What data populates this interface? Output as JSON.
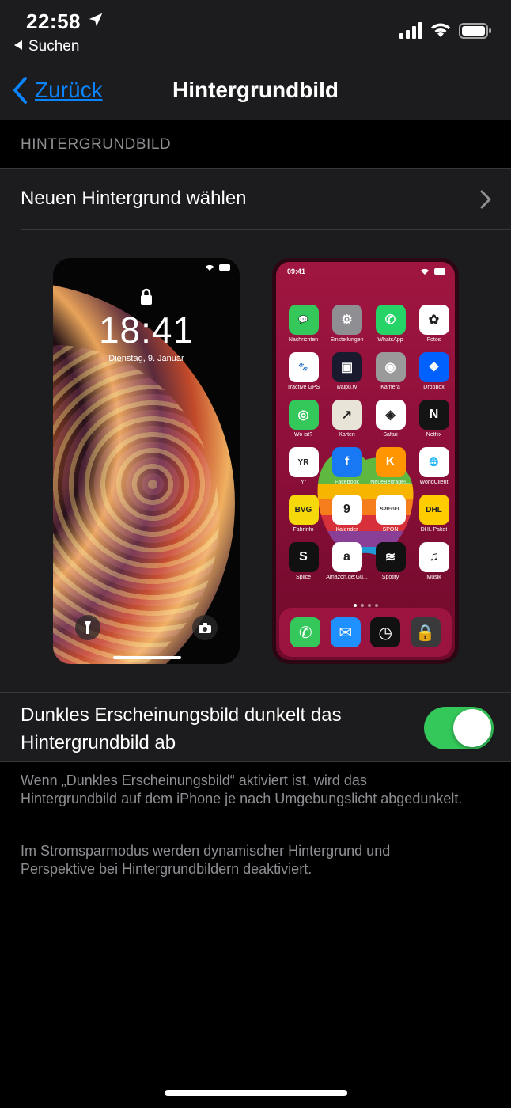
{
  "status_bar": {
    "time": "22:58",
    "back_app_label": "Suchen"
  },
  "nav": {
    "back_label": "Zurück",
    "title": "Hintergrundbild"
  },
  "section_header": "HINTERGRUNDBILD",
  "choose_row_label": "Neuen Hintergrund wählen",
  "lock_preview": {
    "time": "18:41",
    "date": "Dienstag, 9. Januar"
  },
  "home_preview": {
    "time": "09:41",
    "apps": [
      {
        "name": "Nachrichten",
        "color": "#34c759",
        "glyph": "💬"
      },
      {
        "name": "Einstellungen",
        "color": "#8e8e93",
        "glyph": "⚙"
      },
      {
        "name": "WhatsApp",
        "color": "#25d366",
        "glyph": "✆"
      },
      {
        "name": "Fotos",
        "color": "#ffffff",
        "glyph": "✿"
      },
      {
        "name": "Tractive GPS",
        "color": "#ffffff",
        "glyph": "🐾"
      },
      {
        "name": "waipu.tv",
        "color": "#1a1a2e",
        "glyph": "▣"
      },
      {
        "name": "Kamera",
        "color": "#9a9a9a",
        "glyph": "◉"
      },
      {
        "name": "Dropbox",
        "color": "#0061ff",
        "glyph": "❖"
      },
      {
        "name": "Wo ist?",
        "color": "#34c759",
        "glyph": "◎"
      },
      {
        "name": "Karten",
        "color": "#e9e4d8",
        "glyph": "↗"
      },
      {
        "name": "Safari",
        "color": "#ffffff",
        "glyph": "◈"
      },
      {
        "name": "Netflix",
        "color": "#141414",
        "glyph": "N"
      },
      {
        "name": "Yr",
        "color": "#ffffff",
        "glyph": "YR"
      },
      {
        "name": "Facebook",
        "color": "#1877f2",
        "glyph": "f"
      },
      {
        "name": "NeueBeiträge|...",
        "color": "#ff9500",
        "glyph": "K"
      },
      {
        "name": "WorldClient",
        "color": "#ffffff",
        "glyph": "🌐"
      },
      {
        "name": "FahrInfo",
        "color": "#f5d90a",
        "glyph": "BVG"
      },
      {
        "name": "Kalender",
        "color": "#ffffff",
        "glyph": "9"
      },
      {
        "name": "SPON",
        "color": "#ffffff",
        "glyph": "SPIEGEL"
      },
      {
        "name": "DHL Paket",
        "color": "#ffcc00",
        "glyph": "DHL"
      },
      {
        "name": "Splice",
        "color": "#111111",
        "glyph": "S"
      },
      {
        "name": "Amazon.de:Gü...",
        "color": "#ffffff",
        "glyph": "a"
      },
      {
        "name": "Spotify",
        "color": "#111111",
        "glyph": "≋"
      },
      {
        "name": "Musik",
        "color": "#ffffff",
        "glyph": "♫"
      }
    ],
    "dock": [
      {
        "name": "phone-icon",
        "color": "#34c759",
        "glyph": "✆"
      },
      {
        "name": "mail-icon",
        "color": "#1e90ff",
        "glyph": "✉"
      },
      {
        "name": "clock-icon",
        "color": "#111111",
        "glyph": "◷"
      },
      {
        "name": "lock-app-icon",
        "color": "#3a3a3c",
        "glyph": "🔒"
      }
    ]
  },
  "toggle_row": {
    "label": "Dunkles Erscheinungsbild dunkelt das Hintergrundbild ab",
    "on": true
  },
  "footnotes": [
    "Wenn „Dunkles Erscheinungsbild“ aktiviert ist, wird das Hintergrundbild auf dem iPhone je nach Umgebungslicht abgedunkelt.",
    "Im Stromsparmodus werden dynamischer Hintergrund und Perspektive bei Hintergrundbildern deaktiviert."
  ],
  "colors": {
    "accent": "#0a84ff",
    "toggle_on": "#34c759"
  }
}
